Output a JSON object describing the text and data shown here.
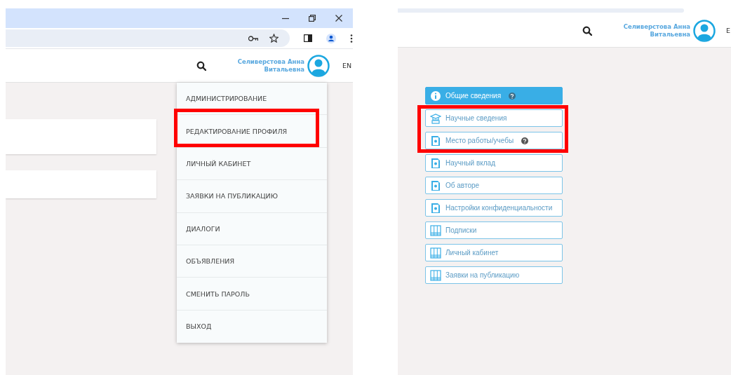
{
  "panels": [
    {
      "kind": "menu",
      "browser": true,
      "header": {
        "user_name": [
          "Селиверстова Анна",
          "Витальевна"
        ],
        "language": "EN"
      },
      "menu": [
        {
          "label": "АДМИНИСТРИРОВАНИЕ",
          "highlighted": false
        },
        {
          "label": "РЕДАКТИРОВАНИЕ ПРОФИЛЯ",
          "highlighted": true
        },
        {
          "label": "ЛИЧНЫЙ КАБИНЕТ",
          "highlighted": false
        },
        {
          "label": "ЗАЯВКИ НА ПУБЛИКАЦИЮ",
          "highlighted": false
        },
        {
          "label": "ДИАЛОГИ",
          "highlighted": false
        },
        {
          "label": "ОБЪЯВЛЕНИЯ",
          "highlighted": false
        },
        {
          "label": "СМЕНИТЬ ПАРОЛЬ",
          "highlighted": false
        },
        {
          "label": "ВЫХОД",
          "highlighted": false
        }
      ]
    },
    {
      "kind": "nav",
      "browser": false,
      "header": {
        "user_name": [
          "Селиверстова Анна",
          "Витальевна"
        ],
        "language": "E"
      },
      "nav": [
        {
          "label": "Общие сведения",
          "kind": "info",
          "help": true,
          "selected": true,
          "highlighted": false
        },
        {
          "label": "Научные сведения",
          "kind": "cap",
          "help": false,
          "selected": false,
          "highlighted": true
        },
        {
          "label": "Место работы/учебы",
          "kind": "doc",
          "help": true,
          "selected": false,
          "highlighted": true
        },
        {
          "label": "Научный вклад",
          "kind": "doc",
          "help": false,
          "selected": false,
          "highlighted": false
        },
        {
          "label": "Об авторе",
          "kind": "doc",
          "help": false,
          "selected": false,
          "highlighted": false
        },
        {
          "label": "Настройки конфиденциальности",
          "kind": "doc",
          "help": false,
          "selected": false,
          "highlighted": false
        },
        {
          "label": "Подписки",
          "kind": "table",
          "help": false,
          "selected": false,
          "highlighted": false
        },
        {
          "label": "Личный кабинет",
          "kind": "table",
          "help": false,
          "selected": false,
          "highlighted": false
        },
        {
          "label": "Заявки на публикацию",
          "kind": "table",
          "help": false,
          "selected": false,
          "highlighted": false
        }
      ]
    }
  ]
}
